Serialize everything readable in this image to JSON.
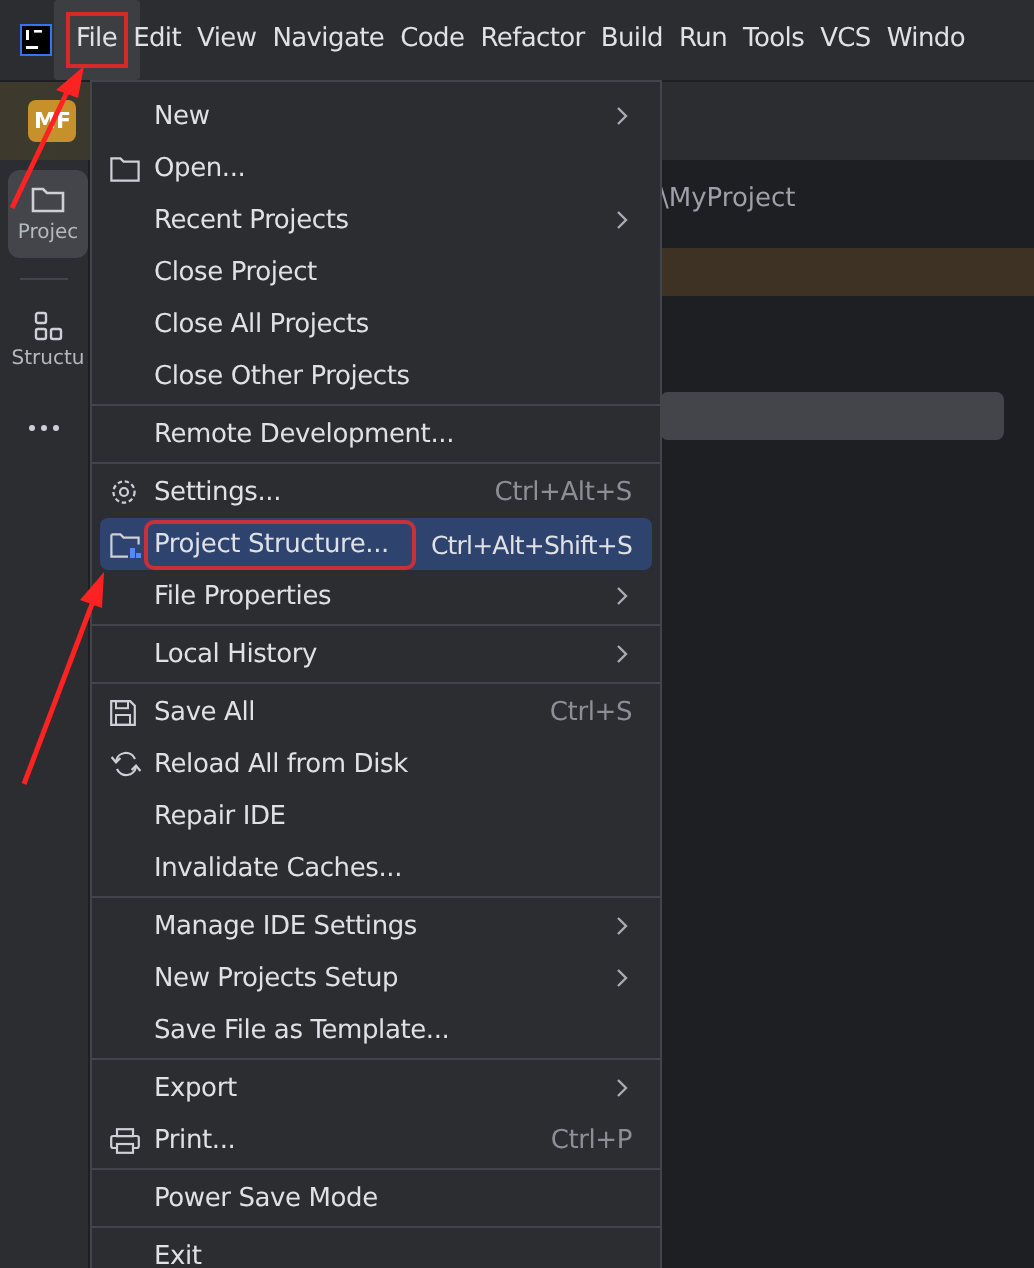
{
  "menu_bar": {
    "items": [
      {
        "label": "File",
        "selected": true,
        "highlighted": true
      },
      {
        "label": "Edit",
        "selected": false,
        "highlighted": false
      },
      {
        "label": "View",
        "selected": false,
        "highlighted": false
      },
      {
        "label": "Navigate",
        "selected": false,
        "highlighted": false
      },
      {
        "label": "Code",
        "selected": false,
        "highlighted": false
      },
      {
        "label": "Refactor",
        "selected": false,
        "highlighted": false
      },
      {
        "label": "Build",
        "selected": false,
        "highlighted": false
      },
      {
        "label": "Run",
        "selected": false,
        "highlighted": false
      },
      {
        "label": "Tools",
        "selected": false,
        "highlighted": false
      },
      {
        "label": "VCS",
        "selected": false,
        "highlighted": false
      },
      {
        "label": "Windo",
        "selected": false,
        "highlighted": false
      }
    ]
  },
  "toolbar": {
    "project_badge": "MF"
  },
  "sidebar": {
    "items": [
      {
        "label": "Projec",
        "kind": "folder",
        "selected": true
      },
      {
        "label": "Structu",
        "kind": "structure",
        "selected": false
      }
    ]
  },
  "editor": {
    "path_text": "\\MyProject"
  },
  "file_menu": {
    "groups": [
      [
        {
          "label": "New",
          "submenu": true,
          "selected": false,
          "highlighted": false
        },
        {
          "label": "Open...",
          "kind": "folder",
          "submenu": false,
          "selected": false,
          "highlighted": false
        },
        {
          "label": "Recent Projects",
          "submenu": true,
          "selected": false,
          "highlighted": false
        },
        {
          "label": "Close Project",
          "submenu": false,
          "selected": false,
          "highlighted": false
        },
        {
          "label": "Close All Projects",
          "submenu": false,
          "selected": false,
          "highlighted": false
        },
        {
          "label": "Close Other Projects",
          "submenu": false,
          "selected": false,
          "highlighted": false
        }
      ],
      [
        {
          "label": "Remote Development...",
          "submenu": false,
          "selected": false,
          "highlighted": false
        }
      ],
      [
        {
          "label": "Settings...",
          "kind": "gear",
          "shortcut": "Ctrl+Alt+S",
          "submenu": false,
          "selected": false,
          "highlighted": false
        },
        {
          "label": "Project Structure...",
          "kind": "project-structure",
          "shortcut": "Ctrl+Alt+Shift+S",
          "submenu": false,
          "selected": true,
          "highlighted": true
        },
        {
          "label": "File Properties",
          "submenu": true,
          "selected": false,
          "highlighted": false
        }
      ],
      [
        {
          "label": "Local History",
          "submenu": true,
          "selected": false,
          "highlighted": false
        }
      ],
      [
        {
          "label": "Save All",
          "kind": "save",
          "shortcut": "Ctrl+S",
          "submenu": false,
          "selected": false,
          "highlighted": false
        },
        {
          "label": "Reload All from Disk",
          "kind": "reload",
          "submenu": false,
          "selected": false,
          "highlighted": false
        },
        {
          "label": "Repair IDE",
          "submenu": false,
          "selected": false,
          "highlighted": false
        },
        {
          "label": "Invalidate Caches...",
          "submenu": false,
          "selected": false,
          "highlighted": false
        }
      ],
      [
        {
          "label": "Manage IDE Settings",
          "submenu": true,
          "selected": false,
          "highlighted": false
        },
        {
          "label": "New Projects Setup",
          "submenu": true,
          "selected": false,
          "highlighted": false
        },
        {
          "label": "Save File as Template...",
          "submenu": false,
          "selected": false,
          "highlighted": false
        }
      ],
      [
        {
          "label": "Export",
          "submenu": true,
          "selected": false,
          "highlighted": false
        },
        {
          "label": "Print...",
          "kind": "print",
          "shortcut": "Ctrl+P",
          "submenu": false,
          "selected": false,
          "highlighted": false
        }
      ],
      [
        {
          "label": "Power Save Mode",
          "submenu": false,
          "selected": false,
          "highlighted": false
        }
      ],
      [
        {
          "label": "Exit",
          "submenu": false,
          "selected": false,
          "highlighted": false
        }
      ]
    ]
  }
}
